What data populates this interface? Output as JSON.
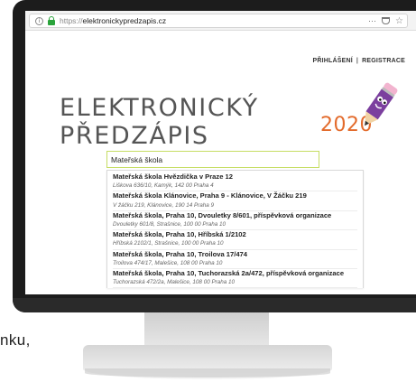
{
  "browser": {
    "url_protocol": "https://",
    "url_host": "elektronickypredzapis.cz",
    "info_glyph": "i",
    "more_glyph": "···",
    "star_glyph": "☆"
  },
  "nav": {
    "login": "PŘIHLÁŠENÍ",
    "separator": "|",
    "register": "REGISTRACE"
  },
  "logo": {
    "title": "ELEKTRONICKÝ PŘEDZÁPIS",
    "year": "2020"
  },
  "search": {
    "value": "Mateřská škola",
    "border_color": "#c6dd63"
  },
  "results": [
    {
      "name": "Mateřská škola Hvězdička v Praze 12",
      "address": "Liškova 636/10, Kamýk, 142 00 Praha 4"
    },
    {
      "name": "Mateřská škola Klánovice, Praha 9 - Klánovice, V Žáčku 219",
      "address": "V žáčku 219, Klánovice, 190 14 Praha 9"
    },
    {
      "name": "Mateřská škola, Praha 10, Dvouletky 8/601, příspěvková organizace",
      "address": "Dvouletky 601/8, Strašnice, 100 00 Praha 10"
    },
    {
      "name": "Mateřská škola, Praha 10, Hříbská 1/2102",
      "address": "Hříbská 2102/1, Strašnice, 100 00 Praha 10"
    },
    {
      "name": "Mateřská škola, Praha 10, Troilova 17/474",
      "address": "Troilova 474/17, Malešice, 108 00 Praha 10"
    },
    {
      "name": "Mateřská škola, Praha 10, Tuchorazská 2a/472, příspěvková organizace",
      "address": "Tuchorazská 472/2a, Malešice, 108 00 Praha 10"
    }
  ],
  "side_text": "nku,",
  "colors": {
    "accent_orange": "#e36b2c",
    "mascot_purple": "#7b3f9e",
    "lock_green": "#2aa33b"
  }
}
